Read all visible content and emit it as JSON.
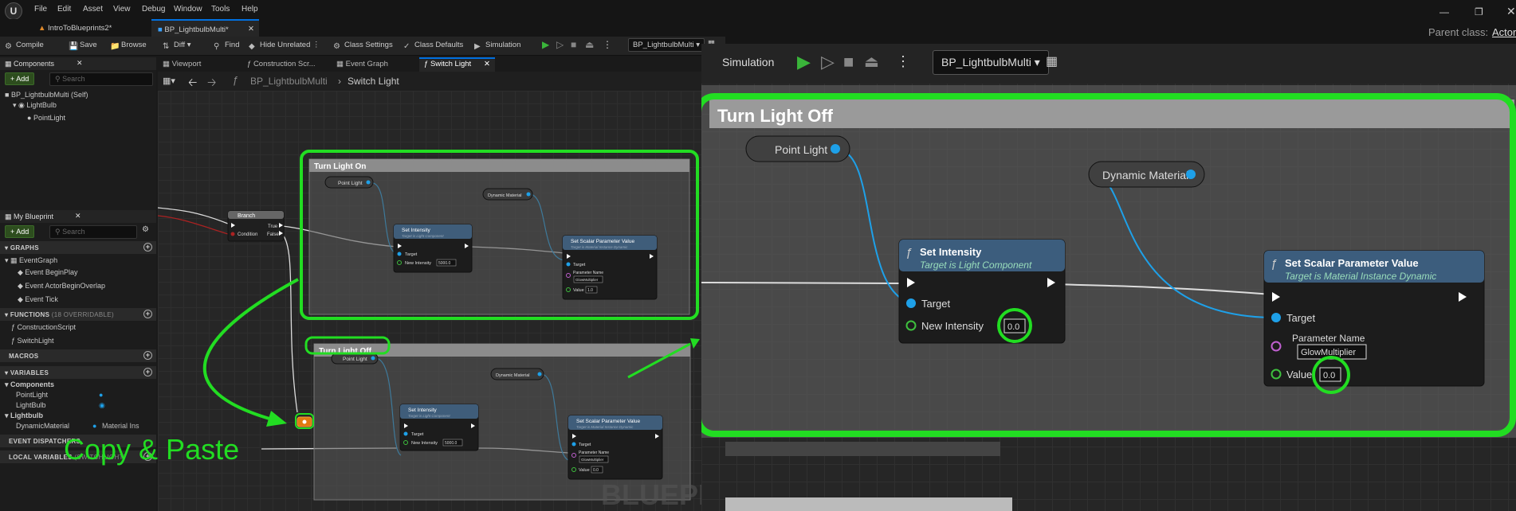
{
  "menu": {
    "items": [
      "File",
      "Edit",
      "Asset",
      "View",
      "Debug",
      "Window",
      "Tools",
      "Help"
    ]
  },
  "doc_tabs": [
    "IntroToBlueprints2*",
    "BP_LightbulbMulti*"
  ],
  "toolbar": {
    "compile": "Compile",
    "save": "Save",
    "browse": "Browse",
    "diff": "Diff",
    "find": "Find",
    "hide_unrelated": "Hide Unrelated",
    "class_settings": "Class Settings",
    "class_defaults": "Class Defaults",
    "simulation": "Simulation",
    "debug_object": "BP_LightbulbMulti"
  },
  "zoom_toolbar": {
    "simulation": "Simulation",
    "debug_object": "BP_LightbulbMulti",
    "parent_class_label": "Parent class:",
    "parent_class_value": "Actor"
  },
  "components": {
    "title": "Components",
    "add": "+ Add",
    "search_placeholder": "Search",
    "items": [
      "BP_LightbulbMulti (Self)",
      "LightBulb",
      "PointLight"
    ]
  },
  "my_blueprint": {
    "title": "My Blueprint",
    "add": "+ Add",
    "search_placeholder": "Search",
    "graphs_header": "GRAPHS",
    "event_graph": "EventGraph",
    "events": [
      "Event BeginPlay",
      "Event ActorBeginOverlap",
      "Event Tick"
    ],
    "functions_header": "FUNCTIONS",
    "functions_suffix": "(18 OVERRIDABLE)",
    "functions": [
      "ConstructionScript",
      "SwitchLight"
    ],
    "macros_header": "MACROS",
    "variables_header": "VARIABLES",
    "var_group_components": "Components",
    "vars_components": [
      "PointLight",
      "LightBulb"
    ],
    "var_group_lightbulb": "Lightbulb",
    "var_dynamic_material": "DynamicMaterial",
    "var_dynamic_type": "Material Ins",
    "event_dispatchers_header": "EVENT DISPATCHERS",
    "local_variables_header": "LOCAL VARIABLES",
    "local_variables_suffix": "(SWITCHLIGHT)"
  },
  "graph_tabs": [
    "Viewport",
    "Construction Scr...",
    "Event Graph",
    "Switch Light"
  ],
  "breadcrumb": {
    "root": "BP_LightbulbMulti",
    "current": "Switch Light"
  },
  "graph": {
    "branch_title": "Branch",
    "branch_condition": "Condition",
    "branch_true": "True",
    "branch_false": "False",
    "comment_on": "Turn Light On",
    "comment_off": "Turn Light Off",
    "point_light": "Point Light",
    "dynamic_material": "Dynamic Material",
    "set_intensity": "Set Intensity",
    "set_intensity_sub": "Target is Light Component",
    "set_scalar": "Set Scalar Parameter Value",
    "set_scalar_sub": "Target is Material Instance Dynamic",
    "target": "Target",
    "new_intensity": "New Intensity",
    "param_name": "Parameter Name",
    "param_value": "GlowMultiplier",
    "value": "Value",
    "on_intensity": "5000.0",
    "on_value": "1.0",
    "off_intensity": "5000.0",
    "off_value": "0.0",
    "watermark": "BLUEPRI"
  },
  "zoom": {
    "comment": "Turn Light Off",
    "point_light": "Point Light",
    "dynamic_material": "Dynamic Material",
    "set_intensity": "Set Intensity",
    "set_intensity_sub": "Target is Light Component",
    "set_scalar": "Set Scalar Parameter Value",
    "set_scalar_sub": "Target is Material Instance Dynamic",
    "target": "Target",
    "new_intensity": "New Intensity",
    "intensity_value": "0.0",
    "param_name": "Parameter Name",
    "param_value": "GlowMultiplier",
    "value": "Value",
    "value_value": "0.0"
  },
  "annotation": {
    "text": "Copy & Paste"
  },
  "colors": {
    "highlight": "#22dd22",
    "accent": "#0070e0",
    "pin_blue": "#1ea0e8",
    "pin_green": "#3ec03e",
    "pin_pink": "#c060d0"
  }
}
